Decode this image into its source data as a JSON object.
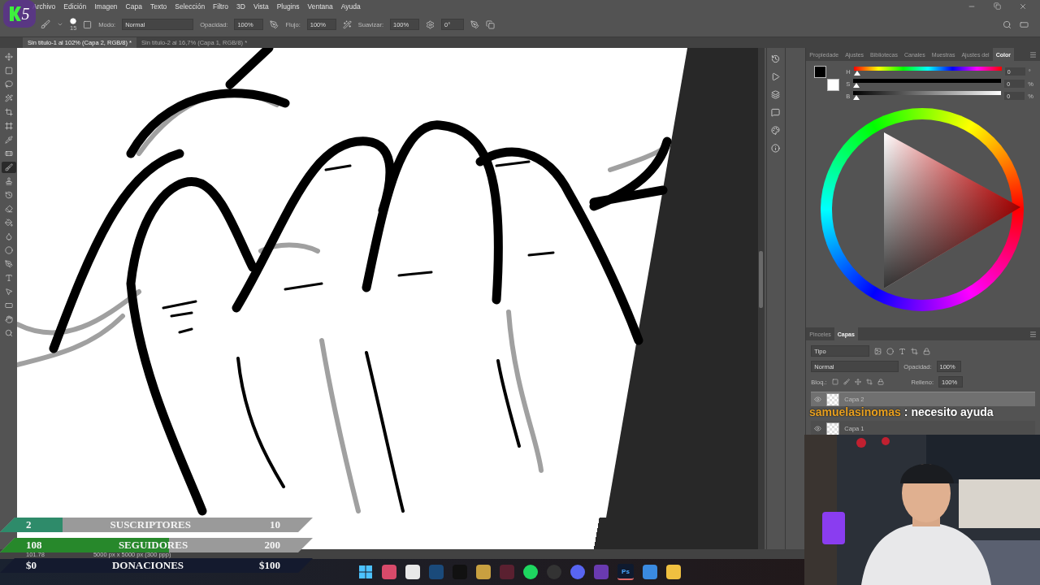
{
  "logo": {
    "text": "5"
  },
  "menu_bar": {
    "items": [
      "Archivo",
      "Edición",
      "Imagen",
      "Capa",
      "Texto",
      "Selección",
      "Filtro",
      "3D",
      "Vista",
      "Plugins",
      "Ventana",
      "Ayuda"
    ]
  },
  "options_bar": {
    "brush_size": "15",
    "mode_label": "Modo:",
    "mode_value": "Normal",
    "opacity_label": "Opacidad:",
    "opacity_value": "100%",
    "flow_label": "Flujo:",
    "flow_value": "100%",
    "smoothing_label": "Suavizar:",
    "smoothing_value": "100%",
    "angle_value": "0°"
  },
  "document_tabs": [
    {
      "label": "Sin título-1 al 102% (Capa 2, RGB/8) *",
      "selected": true
    },
    {
      "label": "Sin título-2 al 16,7% (Capa 1, RGB/8) *",
      "selected": false
    }
  ],
  "tools": [
    {
      "kind": "move",
      "selected": false
    },
    {
      "kind": "marquee",
      "selected": false
    },
    {
      "kind": "lasso",
      "selected": false
    },
    {
      "kind": "wand",
      "selected": false
    },
    {
      "kind": "crop",
      "selected": false
    },
    {
      "kind": "frame",
      "selected": false
    },
    {
      "kind": "eyedropper",
      "selected": false
    },
    {
      "kind": "heal",
      "selected": false
    },
    {
      "kind": "brush",
      "selected": true
    },
    {
      "kind": "stamp",
      "selected": false
    },
    {
      "kind": "history",
      "selected": false
    },
    {
      "kind": "eraser",
      "selected": false
    },
    {
      "kind": "bucket",
      "selected": false
    },
    {
      "kind": "blur",
      "selected": false
    },
    {
      "kind": "dodge",
      "selected": false
    },
    {
      "kind": "pen",
      "selected": false
    },
    {
      "kind": "type",
      "selected": false
    },
    {
      "kind": "path",
      "selected": false
    },
    {
      "kind": "shape",
      "selected": false
    },
    {
      "kind": "hand",
      "selected": false
    },
    {
      "kind": "zoom",
      "selected": false
    }
  ],
  "color_panel": {
    "tabs": [
      {
        "label": "Propiedade",
        "selected": false
      },
      {
        "label": "Ajustes",
        "selected": false
      },
      {
        "label": "Bibliotecas",
        "selected": false
      },
      {
        "label": "Canales",
        "selected": false
      },
      {
        "label": "Muestras",
        "selected": false
      },
      {
        "label": "Ajustes del",
        "selected": false
      },
      {
        "label": "Color",
        "selected": true
      }
    ],
    "sliders": [
      {
        "kind": "hue",
        "label": "H",
        "value": "0",
        "unit": "°",
        "level": 0
      },
      {
        "kind": "saturation",
        "label": "S",
        "value": "0",
        "unit": "%",
        "level": 0
      },
      {
        "kind": "brightness",
        "label": "B",
        "value": "0",
        "unit": "%",
        "level": 0
      }
    ]
  },
  "layers_panel": {
    "tabs": [
      {
        "label": "Pinceles",
        "selected": false
      },
      {
        "label": "Capas",
        "selected": true
      }
    ],
    "filter": "Tipo",
    "blend_mode": "Normal",
    "opacity_label": "Opacidad:",
    "opacity_value": "100%",
    "lock_label": "Bloq.:",
    "fill_label": "Relleno:",
    "fill_value": "100%",
    "layers": [
      {
        "name": "Capa 2",
        "selected": true
      },
      {
        "name": "Capa 1",
        "selected": false
      }
    ]
  },
  "chat": {
    "user": "samuelasinomas",
    "message": ": necesito ayuda"
  },
  "goals": [
    {
      "kind": "count",
      "current": "2",
      "label": "SUSCRIPTORES",
      "target": "10",
      "level": 0.2,
      "color": "#2e8b6a"
    },
    {
      "kind": "count",
      "current": "108",
      "label": "SEGUIDORES",
      "target": "200",
      "level": 0.54,
      "color": "#27882b"
    },
    {
      "kind": "money",
      "current": "$0",
      "label": "DONACIONES",
      "target": "$100"
    }
  ],
  "status_bar": {
    "zoom": "101.78",
    "size": "5000 px x 5000 px (300 ppp)"
  },
  "taskbar": {
    "active_app": "Ps"
  }
}
